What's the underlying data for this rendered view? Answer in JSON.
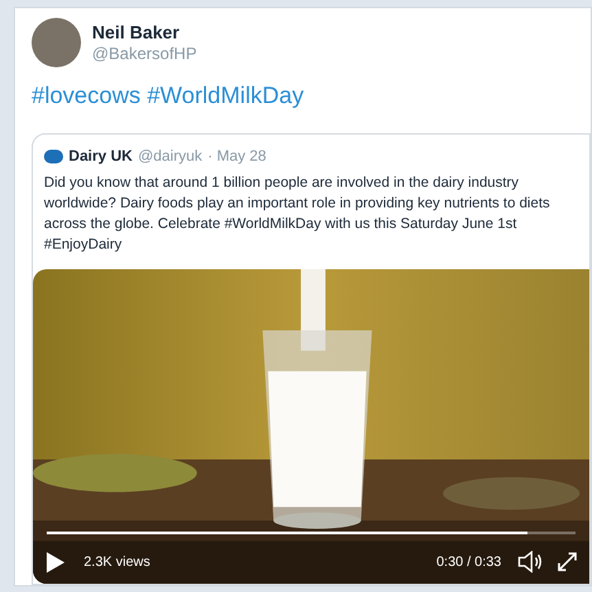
{
  "tweet": {
    "name": "Neil Baker",
    "handle": "@BakersofHP",
    "text": "#lovecows #WorldMilkDay"
  },
  "quoted": {
    "name": "Dairy UK",
    "handle": "@dairyuk",
    "date": "· May 28",
    "text": "Did you know that around 1 billion people are involved in the dairy industry worldwide? Dairy foods play an important role in providing key nutrients to diets across the globe. Celebrate #WorldMilkDay with us this Saturday June 1st #EnjoyDairy"
  },
  "video": {
    "kind": "picture",
    "views": "2.3K views",
    "time": "0:30 / 0:33",
    "progress": {
      "level": 0.91
    }
  }
}
